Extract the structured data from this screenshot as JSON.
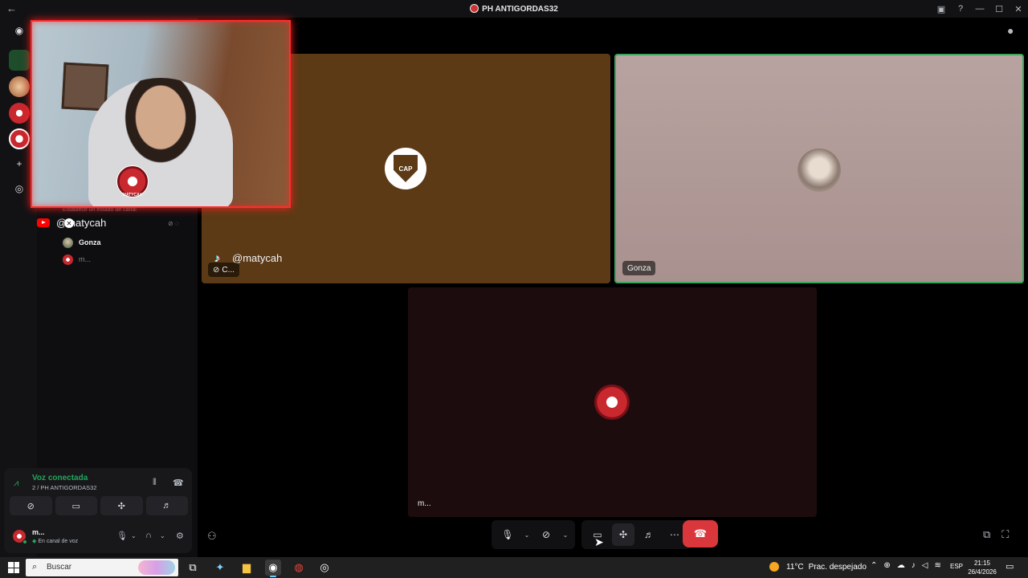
{
  "window": {
    "title": "PH ANTIGORDAS32",
    "back_icon": "←",
    "controls": [
      "minimize",
      "maximize",
      "close"
    ]
  },
  "sidebar": {
    "status_hint": "Establece un estado de canal",
    "youtube_handle": "@matycah",
    "members": [
      {
        "name": "Gonza"
      },
      {
        "name": "m..."
      }
    ]
  },
  "voice_panel": {
    "status": "Voz conectada",
    "channel": "2 / PH ANTIGORDAS32",
    "user_name": "m...",
    "user_status": "En canal de voz"
  },
  "tiles": [
    {
      "id": "cap",
      "tiktok_handle": "@matycah",
      "label": "C...",
      "logo_text": "CAP"
    },
    {
      "id": "gonza",
      "label": "Gonza"
    },
    {
      "id": "m",
      "label": "m..."
    }
  ],
  "camera": {
    "badge_text": "MATYCAH"
  },
  "taskbar": {
    "search_label": "Buscar",
    "temperature": "11°C",
    "condition": "Prac. despejado",
    "language": "ESP",
    "time": "21:15",
    "date": "26/4/2026"
  },
  "colors": {
    "accent_green": "#23a55a",
    "hangup_red": "#da373c",
    "camera_border": "#ff2d2d",
    "speaking_border": "#3ba55c"
  },
  "icons": [
    "discord-icon",
    "add-server-icon",
    "discover-icon",
    "mic-icon",
    "camera-off-icon",
    "screen-share-icon",
    "activities-icon",
    "soundboard-icon",
    "more-icon",
    "hangup-icon",
    "headphones-icon",
    "settings-icon",
    "chat-icon",
    "popout-icon",
    "fullscreen-icon"
  ]
}
